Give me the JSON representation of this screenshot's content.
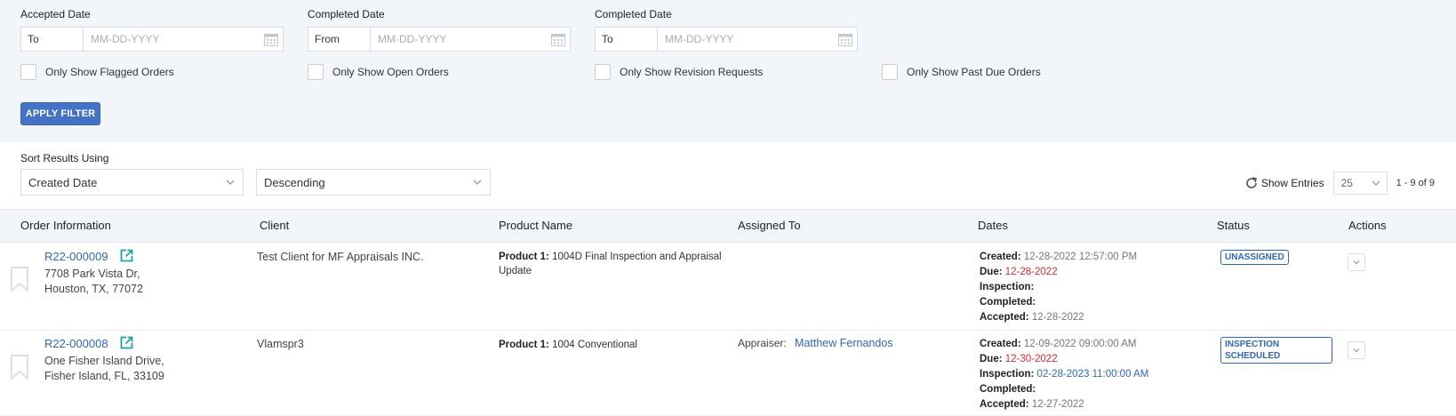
{
  "filters": {
    "date_groups": [
      {
        "label": "Accepted Date",
        "prefix": "To",
        "placeholder": "MM-DD-YYYY"
      },
      {
        "label": "Completed Date",
        "prefix": "From",
        "placeholder": "MM-DD-YYYY"
      },
      {
        "label": "Completed Date",
        "prefix": "To",
        "placeholder": "MM-DD-YYYY"
      }
    ],
    "checkboxes": [
      {
        "label": "Only Show Flagged Orders",
        "checked": false
      },
      {
        "label": "Only Show Open Orders",
        "checked": false
      },
      {
        "label": "Only Show Revision Requests",
        "checked": false
      },
      {
        "label": "Only Show Past Due Orders",
        "checked": false
      }
    ],
    "apply_label": "APPLY FILTER"
  },
  "sort": {
    "label": "Sort Results Using",
    "field": "Created Date",
    "direction": "Descending"
  },
  "entries": {
    "label": "Show Entries",
    "value": "25",
    "range": "1 - 9 of 9"
  },
  "table": {
    "headers": [
      "Order Information",
      "Client",
      "Product Name",
      "Assigned To",
      "Dates",
      "Status",
      "Actions"
    ],
    "rows": [
      {
        "order_id": "R22-000009",
        "address_line1": "7708 Park Vista Dr,",
        "address_line2": "Houston, TX, 77072",
        "client": "Test Client for MF Appraisals INC.",
        "product_label": "Product 1:",
        "product_name": "1004D Final Inspection and Appraisal Update",
        "assigned_role": "",
        "assigned_name": "",
        "created_label": "Created:",
        "created": "12-28-2022 12:57:00 PM",
        "due_label": "Due:",
        "due": "12-28-2022",
        "inspection_label": "Inspection:",
        "inspection": "",
        "completed_label": "Completed:",
        "completed": "",
        "accepted_label": "Accepted:",
        "accepted": "12-28-2022",
        "status": "UNASSIGNED"
      },
      {
        "order_id": "R22-000008",
        "address_line1": "One Fisher Island Drive,",
        "address_line2": "Fisher Island, FL, 33109",
        "client": "Vlamspr3",
        "product_label": "Product 1:",
        "product_name": "1004 Conventional",
        "assigned_role": "Appraiser:",
        "assigned_name": "Matthew Fernandos",
        "created_label": "Created:",
        "created": "12-09-2022 09:00:00 AM",
        "due_label": "Due:",
        "due": "12-30-2022",
        "inspection_label": "Inspection:",
        "inspection": "02-28-2023 11:00:00 AM",
        "completed_label": "Completed:",
        "completed": "",
        "accepted_label": "Accepted:",
        "accepted": "12-27-2022",
        "status": "INSPECTION SCHEDULED"
      }
    ]
  },
  "icons": {
    "calendar": "calendar-icon",
    "checkbox": "checkbox-icon",
    "chevron": "chevron-down-icon",
    "refresh": "refresh-icon",
    "bookmark": "bookmark-icon",
    "external": "external-link-icon"
  },
  "colors": {
    "accent": "#4472c4",
    "link": "#2f67b2",
    "due": "#d9272e",
    "panel": "#f2f5fa"
  }
}
